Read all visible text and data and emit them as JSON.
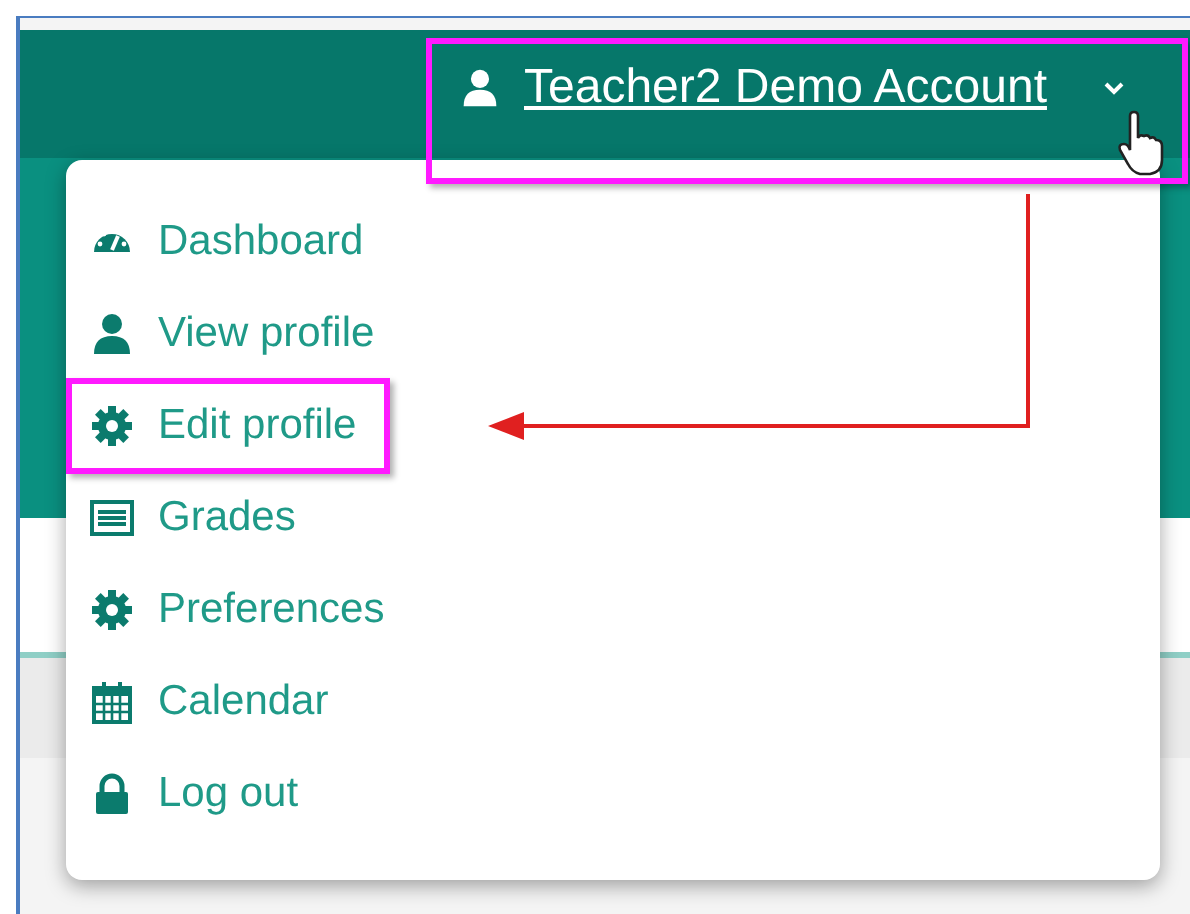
{
  "user_menu": {
    "name": "Teacher2 Demo Account",
    "highlighted": true
  },
  "menu_items": [
    {
      "label": "Dashboard",
      "highlighted": false
    },
    {
      "label": "View profile",
      "highlighted": false
    },
    {
      "label": "Edit profile",
      "highlighted": true
    },
    {
      "label": "Grades",
      "highlighted": false
    },
    {
      "label": "Preferences",
      "highlighted": false
    },
    {
      "label": "Calendar",
      "highlighted": false
    },
    {
      "label": "Log out",
      "highlighted": false
    }
  ]
}
